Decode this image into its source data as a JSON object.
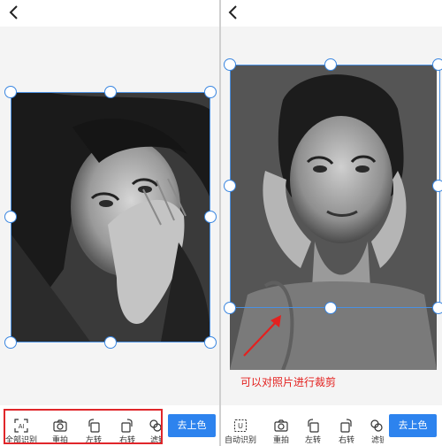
{
  "left_screen": {
    "back_icon": "chevron-left-icon",
    "toolbar": {
      "items": [
        {
          "label": "全部识别",
          "icon": "ai-scan-icon"
        },
        {
          "label": "重拍",
          "icon": "camera-icon"
        },
        {
          "label": "左转",
          "icon": "rotate-left-icon"
        },
        {
          "label": "右转",
          "icon": "rotate-right-icon"
        },
        {
          "label": "滤镜",
          "icon": "filter-icon"
        }
      ],
      "primary_button": "去上色"
    }
  },
  "right_screen": {
    "back_icon": "chevron-left-icon",
    "toolbar": {
      "items": [
        {
          "label": "自动识别",
          "icon": "auto-scan-icon"
        },
        {
          "label": "重拍",
          "icon": "camera-icon"
        },
        {
          "label": "左转",
          "icon": "rotate-left-icon"
        },
        {
          "label": "右转",
          "icon": "rotate-right-icon"
        },
        {
          "label": "滤镜",
          "icon": "filter-icon"
        }
      ],
      "primary_button": "去上色"
    },
    "annotation": "可以对照片进行裁剪"
  },
  "colors": {
    "accent": "#2d83ee",
    "crop_border": "#4a90e2",
    "highlight": "#e0262a",
    "annotation": "#e3211f"
  }
}
